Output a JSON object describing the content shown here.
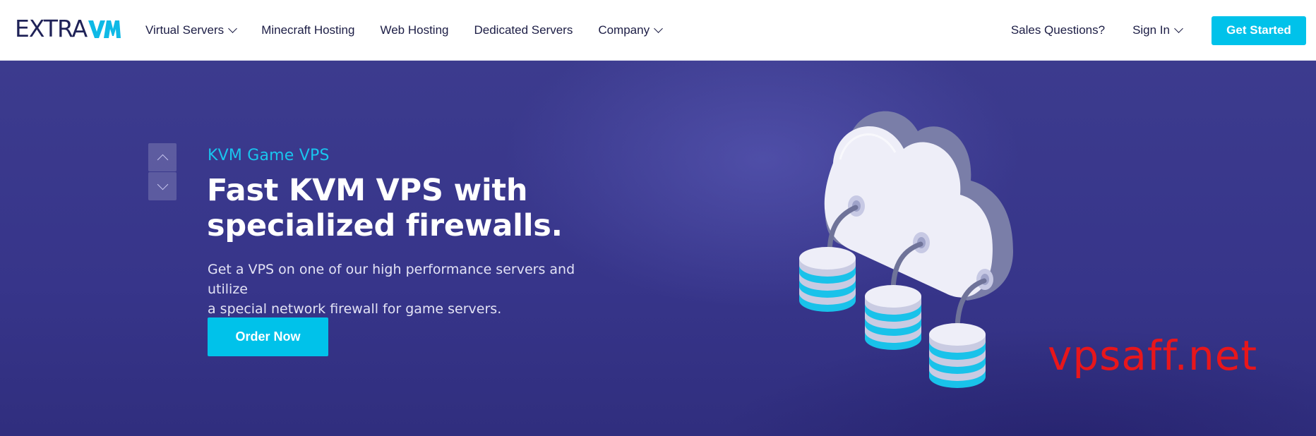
{
  "nav": {
    "logo_text": "EXTRA",
    "logo_mark": "VM",
    "items": [
      {
        "label": "Virtual Servers",
        "has_dropdown": true
      },
      {
        "label": "Minecraft Hosting",
        "has_dropdown": false
      },
      {
        "label": "Web Hosting",
        "has_dropdown": false
      },
      {
        "label": "Dedicated Servers",
        "has_dropdown": false
      },
      {
        "label": "Company",
        "has_dropdown": true
      }
    ],
    "sales": "Sales Questions?",
    "signin": "Sign In",
    "cta": "Get Started"
  },
  "hero": {
    "kicker": "KVM Game VPS",
    "headline_line1": "Fast KVM VPS with",
    "headline_line2": "specialized firewalls.",
    "subtext_line1": "Get a VPS on one of our high performance servers and utilize",
    "subtext_line2": "a special network firewall for game servers.",
    "cta": "Order Now"
  },
  "watermark": "vpsaff.net",
  "colors": {
    "accent": "#00c2ea",
    "nav_text": "#1c1d45",
    "hero_bg": "#37358a",
    "watermark": "#e8161b"
  },
  "icons": [
    "chevron-down-icon",
    "chevron-up-icon",
    "cloud-servers-illustration"
  ]
}
